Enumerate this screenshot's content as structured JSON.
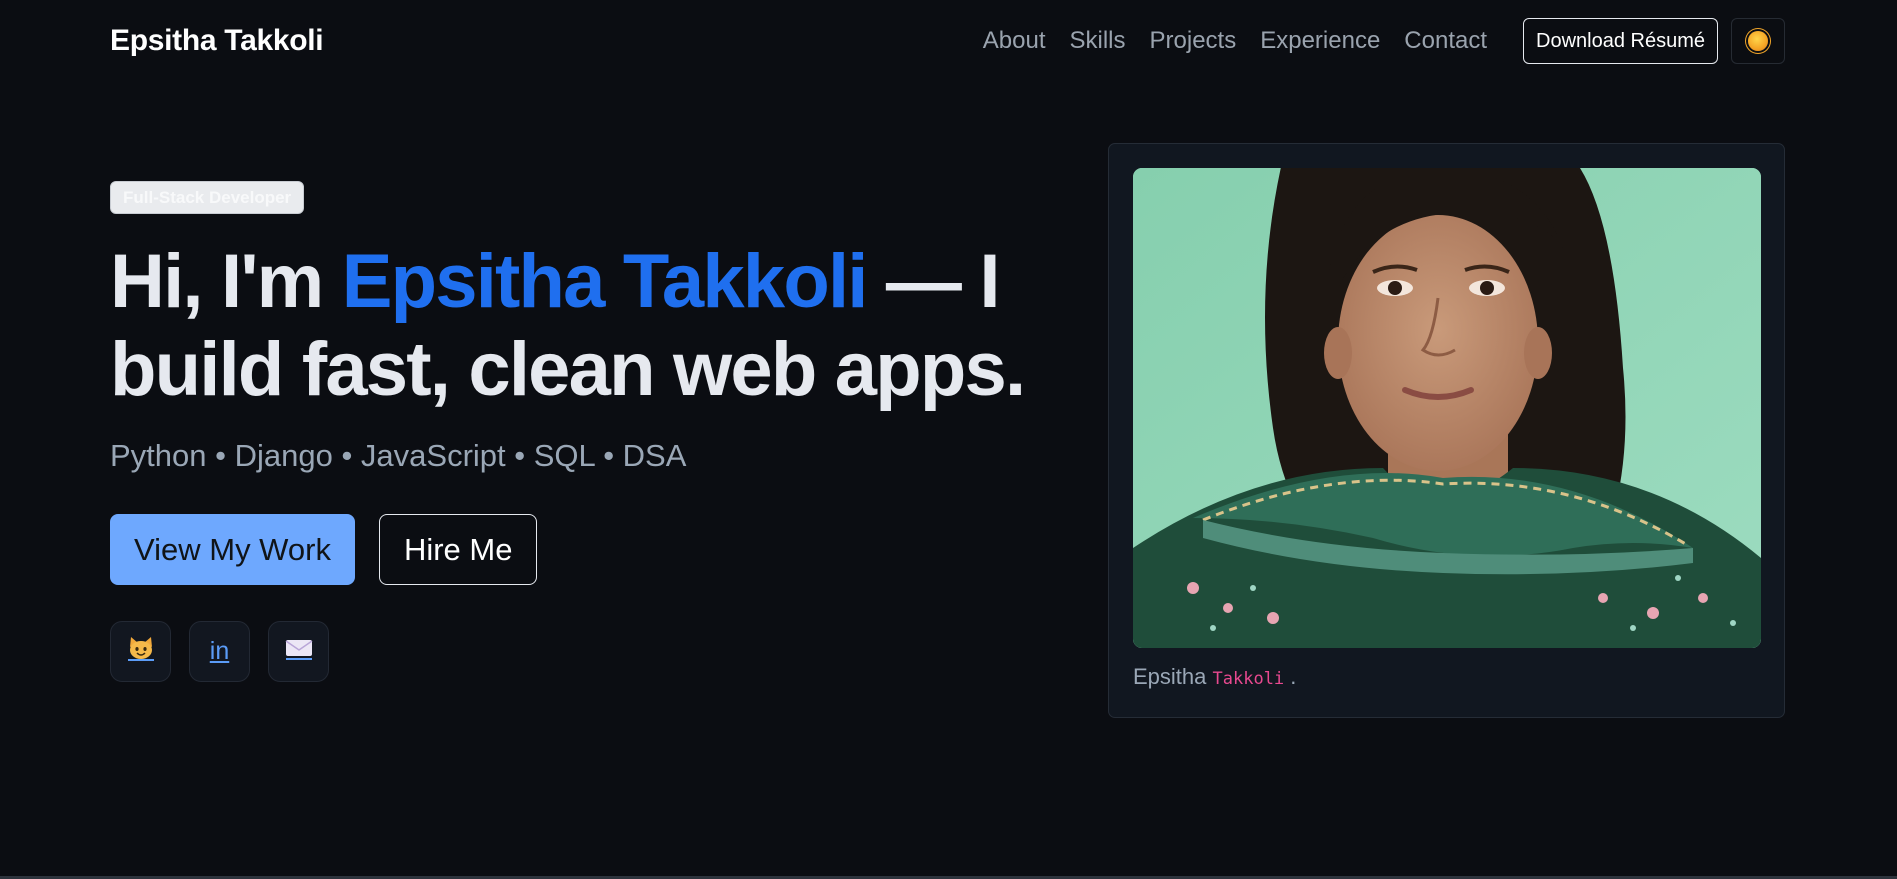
{
  "header": {
    "brand": "Epsitha Takkoli",
    "nav": [
      "About",
      "Skills",
      "Projects",
      "Experience",
      "Contact"
    ],
    "resume_label": "Download Résumé",
    "theme_toggle_icon": "sun-icon"
  },
  "hero": {
    "badge": "Full-Stack Developer",
    "headline_prefix": "Hi, I'm ",
    "headline_name": "Epsitha Takkoli",
    "headline_suffix": " — I build fast, clean web apps.",
    "stack_line": "Python • Django • JavaScript • SQL • DSA",
    "primary_cta": "View My Work",
    "secondary_cta": "Hire Me",
    "socials": [
      {
        "icon": "github-cat-icon"
      },
      {
        "icon": "linkedin-icon",
        "label": "in"
      },
      {
        "icon": "email-icon"
      }
    ]
  },
  "profile": {
    "photo": "portrait-photo",
    "caption_name": "Epsitha",
    "caption_code": "Takkoli",
    "caption_end": "."
  },
  "colors": {
    "background": "#0b0d12",
    "accent": "#1f6fef",
    "primary_button": "#6ea8fe",
    "muted_text": "#9aa3ae",
    "code_pink": "#e8498f"
  }
}
